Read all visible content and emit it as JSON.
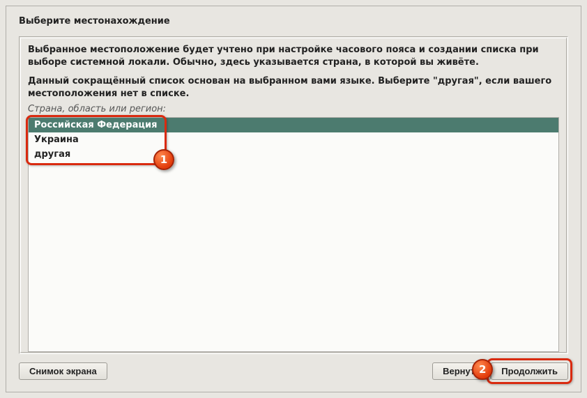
{
  "title": "Выберите местонахождение",
  "desc1": "Выбранное местоположение будет учтено при настройке часового пояса и создании списка при выборе системной локали. Обычно, здесь указывается страна, в которой вы живёте.",
  "desc2": "Данный сокращённый список основан на выбранном вами языке. Выберите \"другая\", если вашего местоположения нет в списке.",
  "list_label": "Страна, область или регион:",
  "items": [
    {
      "label": "Российская Федерация",
      "selected": true
    },
    {
      "label": "Украина",
      "selected": false
    },
    {
      "label": "другая",
      "selected": false
    }
  ],
  "buttons": {
    "screenshot": "Снимок экрана",
    "back": "Вернуть",
    "continue": "Продолжить"
  },
  "annotations": {
    "badge1": "1",
    "badge2": "2"
  }
}
